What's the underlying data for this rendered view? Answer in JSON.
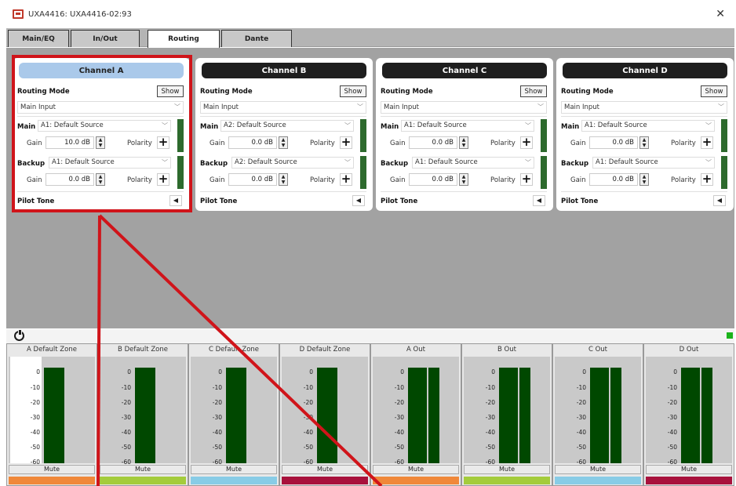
{
  "window": {
    "title": "UXA4416: UXA4416-02:93",
    "close_glyph": "✕"
  },
  "tabs": [
    {
      "label": "Main/EQ"
    },
    {
      "label": "In/Out"
    },
    {
      "label": "Routing",
      "active": true
    },
    {
      "label": "Dante"
    }
  ],
  "common": {
    "routing_mode_label": "Routing Mode",
    "show_label": "Show",
    "routing_mode_value": "Main Input",
    "main_label": "Main",
    "backup_label": "Backup",
    "gain_label": "Gain",
    "polarity_label": "Polarity",
    "pilot_tone_label": "Pilot Tone",
    "plus_glyph": "+",
    "chevron_glyph": "﹀",
    "pilot_glyph": "◀",
    "spin_up": "▲",
    "spin_down": "▼"
  },
  "channels": [
    {
      "name": "Channel A",
      "selected": true,
      "main_source": "A1: Default Source",
      "main_gain": "10.0 dB",
      "backup_source": "A1: Default Source",
      "backup_gain": "0.0 dB"
    },
    {
      "name": "Channel B",
      "selected": false,
      "main_source": "A2: Default Source",
      "main_gain": "0.0 dB",
      "backup_source": "A2: Default Source",
      "backup_gain": "0.0 dB"
    },
    {
      "name": "Channel C",
      "selected": false,
      "main_source": "A1: Default Source",
      "main_gain": "0.0 dB",
      "backup_source": "A1: Default Source",
      "backup_gain": "0.0 dB"
    },
    {
      "name": "Channel D",
      "selected": false,
      "main_source": "A1: Default Source",
      "main_gain": "0.0 dB",
      "backup_source": "A1: Default Source",
      "backup_gain": "0.0 dB"
    }
  ],
  "meters": {
    "scale": [
      "0",
      "-10",
      "-20",
      "-30",
      "-40",
      "-50",
      "-60"
    ],
    "mute_label": "Mute",
    "items": [
      {
        "title": "A Default Zone",
        "bars": 1,
        "color": "#f0883a",
        "scale_bg": "#ffffff"
      },
      {
        "title": "B Default Zone",
        "bars": 1,
        "color": "#a4cc3c",
        "scale_bg": "#c9c9c9"
      },
      {
        "title": "C Default Zone",
        "bars": 1,
        "color": "#88cce6",
        "scale_bg": "#c9c9c9"
      },
      {
        "title": "D Default Zone",
        "bars": 1,
        "color": "#a8113c",
        "scale_bg": "#c9c9c9"
      },
      {
        "title": "A Out",
        "bars": 2,
        "color": "#f0883a",
        "scale_bg": "#c9c9c9"
      },
      {
        "title": "B Out",
        "bars": 2,
        "color": "#a4cc3c",
        "scale_bg": "#c9c9c9"
      },
      {
        "title": "C Out",
        "bars": 2,
        "color": "#88cce6",
        "scale_bg": "#c9c9c9"
      },
      {
        "title": "D Out",
        "bars": 2,
        "color": "#a8113c",
        "scale_bg": "#c9c9c9"
      }
    ]
  },
  "colors": {
    "annotation": "#d0141a",
    "meter_bar": "#004800",
    "status_led": "#1bb31b"
  }
}
